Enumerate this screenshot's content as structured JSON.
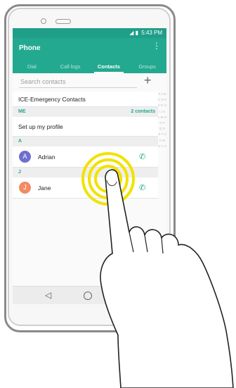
{
  "status_bar": {
    "time": "5:43 PM",
    "signal": "◢ ▮"
  },
  "app": {
    "title": "Phone",
    "menu_icon": "more-vert-icon"
  },
  "tabs": [
    {
      "label": "Dial"
    },
    {
      "label": "Call logs"
    },
    {
      "label": "Contacts"
    },
    {
      "label": "Groups"
    }
  ],
  "active_tab": "Contacts",
  "search": {
    "placeholder": "Search contacts",
    "add_icon": "plus-icon"
  },
  "ice_row": {
    "label": "ICE-Emergency Contacts"
  },
  "sections": {
    "me": {
      "label": "ME",
      "count": "2 contacts"
    },
    "a": {
      "label": "A"
    },
    "j": {
      "label": "J"
    }
  },
  "profile_row": {
    "label": "Set up my profile"
  },
  "contacts": [
    {
      "initial": "A",
      "name": "Adrian",
      "avatar_color": "#6f6fd0",
      "call_icon": "phone-icon"
    },
    {
      "initial": "J",
      "name": "Jane",
      "avatar_color": "#f28a63",
      "call_icon": "phone-icon"
    }
  ],
  "alpha_index": "# A B C D E F G H I J K L M N O P Q R S T U V W X Y Z",
  "colors": {
    "accent": "#23a98f",
    "touch_ring": "#f2e200"
  },
  "nav": {
    "back_icon": "back-triangle-icon",
    "home_icon": "home-circle-icon"
  }
}
